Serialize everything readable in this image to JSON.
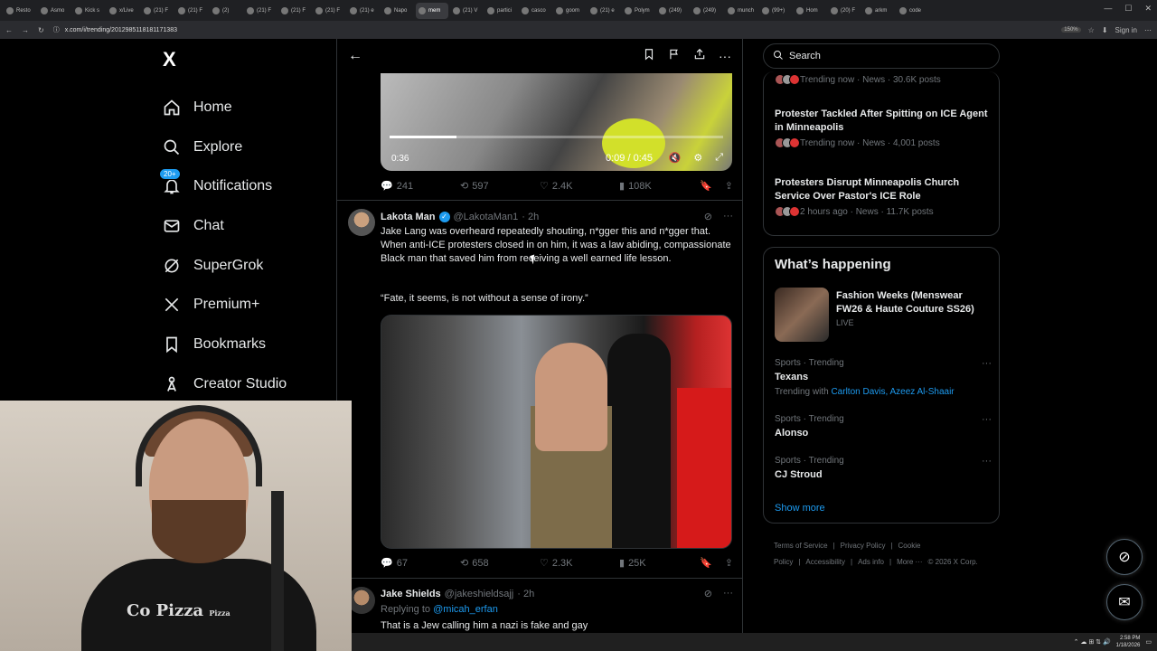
{
  "browser": {
    "tabs": [
      "Resto",
      "Asmo",
      "Kick s",
      "x/Live",
      "(21) F",
      "(21) F",
      "(2)",
      "(21) F",
      "(21) F",
      "(21) F",
      "(21) e",
      "Napo",
      "mem",
      "(21) V",
      "partici",
      "casco",
      "goom",
      "(21) e",
      "Polym",
      "(249)",
      "(249)",
      "munch",
      "(99+)",
      "Hom",
      "(20) F",
      "arkm",
      "code"
    ],
    "active_tab_index": 12,
    "url": "x.com/i/trending/2012985118181171383",
    "zoom": "150%",
    "sign_in": "Sign in"
  },
  "sidebar": {
    "logo": "X",
    "items": [
      {
        "label": "Home",
        "icon": "home-icon"
      },
      {
        "label": "Explore",
        "icon": "search-icon"
      },
      {
        "label": "Notifications",
        "icon": "bell-icon",
        "badge": "20+"
      },
      {
        "label": "Chat",
        "icon": "mail-icon"
      },
      {
        "label": "SuperGrok",
        "icon": "grok-icon"
      },
      {
        "label": "Premium+",
        "icon": "x-icon"
      },
      {
        "label": "Bookmarks",
        "icon": "bookmark-icon"
      },
      {
        "label": "Creator Studio",
        "icon": "creator-icon"
      }
    ]
  },
  "video": {
    "elapsed_label": "0:36",
    "time": "0:09 / 0:45",
    "progress": 0.2
  },
  "post1_metrics": {
    "replies": "241",
    "reposts": "597",
    "likes": "2.4K",
    "views": "108K"
  },
  "post2": {
    "name": "Lakota Man",
    "handle": "@LakotaMan1",
    "time": "· 2h",
    "text": "Jake Lang was overheard repeatedly shouting, n*gger this and n*gger that. When anti-ICE protesters closed in on him, it was a law abiding, compassionate Black man that saved him from receiving a well earned life lesson.",
    "quote": "“Fate, it seems, is not without a sense of irony.”",
    "metrics": {
      "replies": "67",
      "reposts": "658",
      "likes": "2.3K",
      "views": "25K"
    }
  },
  "post3": {
    "name": "Jake Shields",
    "handle": "@jakeshieldsajj",
    "time": "· 2h",
    "replying_label": "Replying to",
    "replying_to": "@micah_erfan",
    "text": "That is a Jew calling him a nazi is fake and gay"
  },
  "search": {
    "placeholder": "Search"
  },
  "trending_now": [
    {
      "meta": "Trending now · News · 30.6K posts"
    },
    {
      "title": "Protester Tackled After Spitting on ICE Agent in Minneapolis",
      "meta": "Trending now · News · 4,001 posts"
    },
    {
      "title": "Protesters Disrupt Minneapolis Church Service Over Pastor's ICE Role",
      "meta": "2 hours ago · News · 11.7K posts"
    }
  ],
  "whats_happening": {
    "heading": "What’s happening",
    "feature": {
      "title": "Fashion Weeks (Menswear FW26 & Haute Couture SS26)",
      "status": "LIVE"
    },
    "trends": [
      {
        "category": "Sports · Trending",
        "name": "Texans",
        "with_label": "Trending with",
        "with": "Carlton Davis, Azeez Al-Shaair"
      },
      {
        "category": "Sports · Trending",
        "name": "Alonso"
      },
      {
        "category": "Sports · Trending",
        "name": "CJ Stroud"
      }
    ],
    "show_more": "Show more"
  },
  "footer": {
    "links": [
      "Terms of Service",
      "|",
      "Privacy Policy",
      "|",
      "Cookie Policy",
      "|",
      "Accessibility",
      "|",
      "Ads info",
      "|",
      "More ···",
      "© 2026 X Corp."
    ]
  },
  "webcam": {
    "shirt_text": "Co  Pizza",
    "shirt_sub": "Pizza"
  },
  "taskbar": {
    "time": "2:58 PM",
    "date": "1/18/2026"
  }
}
